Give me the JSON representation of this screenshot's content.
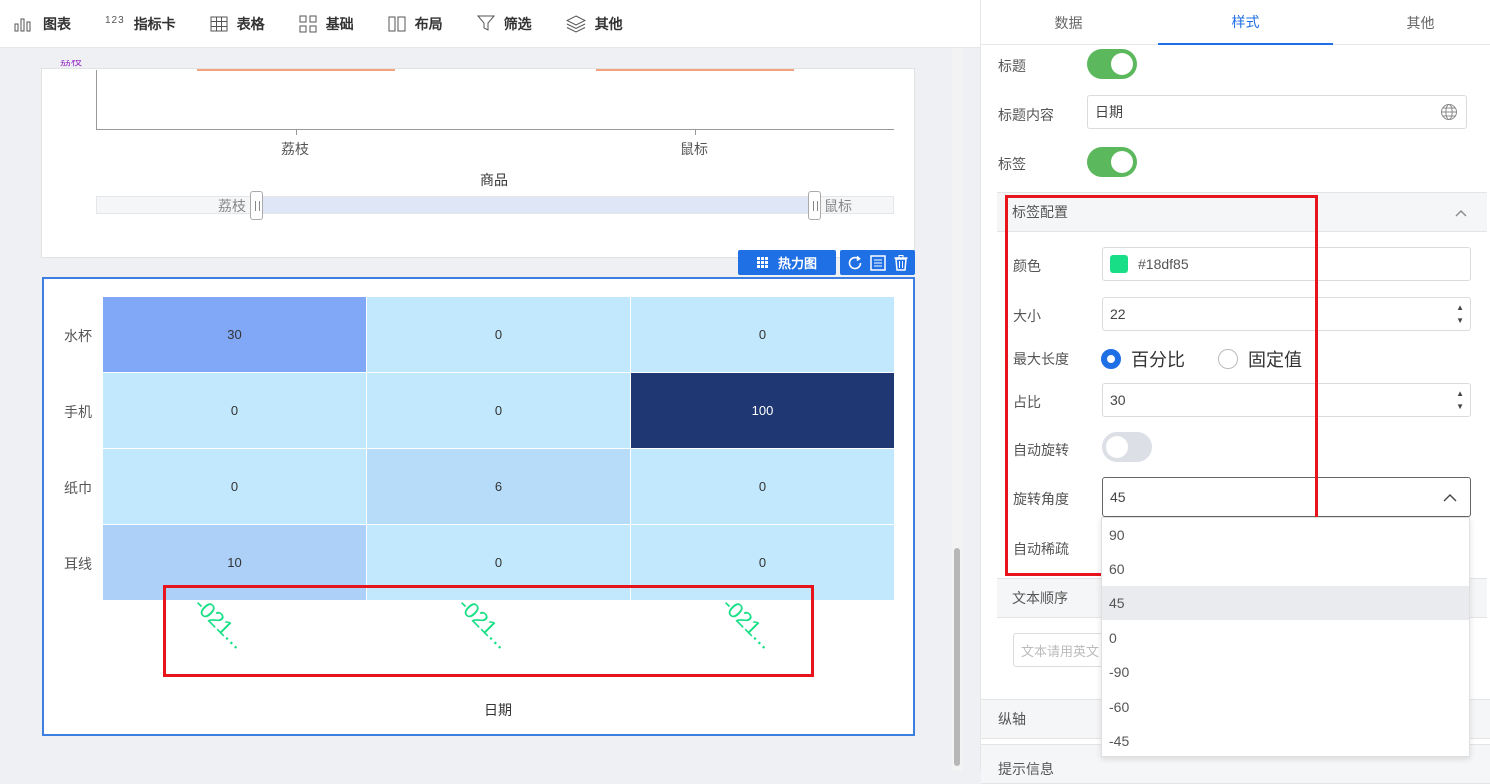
{
  "toolbar": {
    "items": [
      {
        "label": "图表"
      },
      {
        "label": "指标卡",
        "icon_text": "123"
      },
      {
        "label": "表格"
      },
      {
        "label": "基础"
      },
      {
        "label": "布局"
      },
      {
        "label": "筛选"
      },
      {
        "label": "其他"
      }
    ]
  },
  "top_chart": {
    "x_ticks": [
      "荔枝",
      "鼠标"
    ],
    "x_title": "商品",
    "y_cut_label": "荔枝",
    "slider_left": "荔枝",
    "slider_right": "鼠标"
  },
  "heat_chip": {
    "label": "热力图"
  },
  "chart_data": {
    "type": "heatmap",
    "title": "",
    "xlabel": "日期",
    "y_categories": [
      "水杯",
      "手机",
      "纸巾",
      "耳线"
    ],
    "x_tick_label": "-021...",
    "values": [
      [
        30,
        0,
        0
      ],
      [
        0,
        0,
        100
      ],
      [
        0,
        6,
        0
      ],
      [
        10,
        0,
        0
      ]
    ],
    "label_color": "#18df85",
    "label_rotate_deg": 45
  },
  "panel": {
    "tabs": [
      "数据",
      "样式",
      "其他"
    ],
    "active_tab": 1,
    "title_label": "标题",
    "title_content_label": "标题内容",
    "title_content_value": "日期",
    "label_label": "标签",
    "label_config_header": "标签配置",
    "color_label": "颜色",
    "color_value": "#18df85",
    "size_label": "大小",
    "size_value": "22",
    "maxlen_label": "最大长度",
    "radio_percent": "百分比",
    "radio_fixed": "固定值",
    "ratio_label": "占比",
    "ratio_value": "30",
    "auto_rotate_label": "自动旋转",
    "rotate_angle_label": "旋转角度",
    "rotate_angle_value": "45",
    "auto_sparse_label": "自动稀疏",
    "text_order_header": "文本顺序",
    "text_order_placeholder": "文本请用英文",
    "y_axis_header": "纵轴",
    "tooltip_header": "提示信息",
    "angle_options": [
      "90",
      "60",
      "45",
      "0",
      "-90",
      "-60",
      "-45"
    ]
  }
}
